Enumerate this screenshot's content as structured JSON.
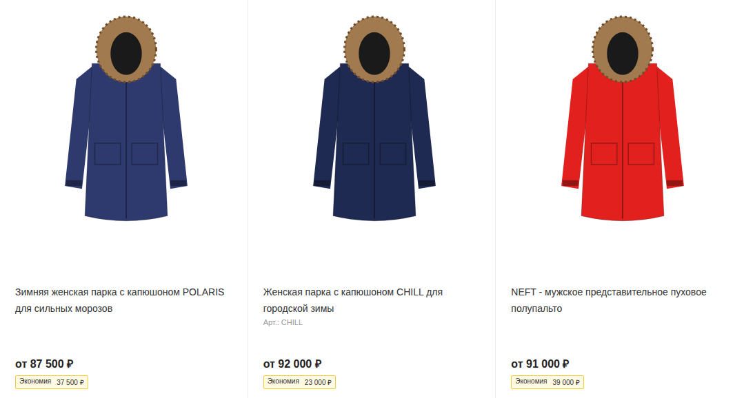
{
  "products": [
    {
      "title": "Зимняя женская парка с капюшоном POLARIS для сильных морозов",
      "price": "от 87 500 ₽",
      "savings_label": "Экономия",
      "savings": "37 500 ₽",
      "color": "#2e3a6e"
    },
    {
      "title": "Женская парка с капюшоном CHILL для городской зимы",
      "article": "Арт.: CHILL",
      "price": "от 92 000 ₽",
      "savings_label": "Экономия",
      "savings": "23 000 ₽",
      "color": "#1f2a52"
    },
    {
      "title": "NEFT - мужское представительное пуховое полупальто",
      "price": "от 91 000 ₽",
      "savings_label": "Экономия",
      "savings": "39 000 ₽",
      "color": "#e2211f"
    }
  ]
}
